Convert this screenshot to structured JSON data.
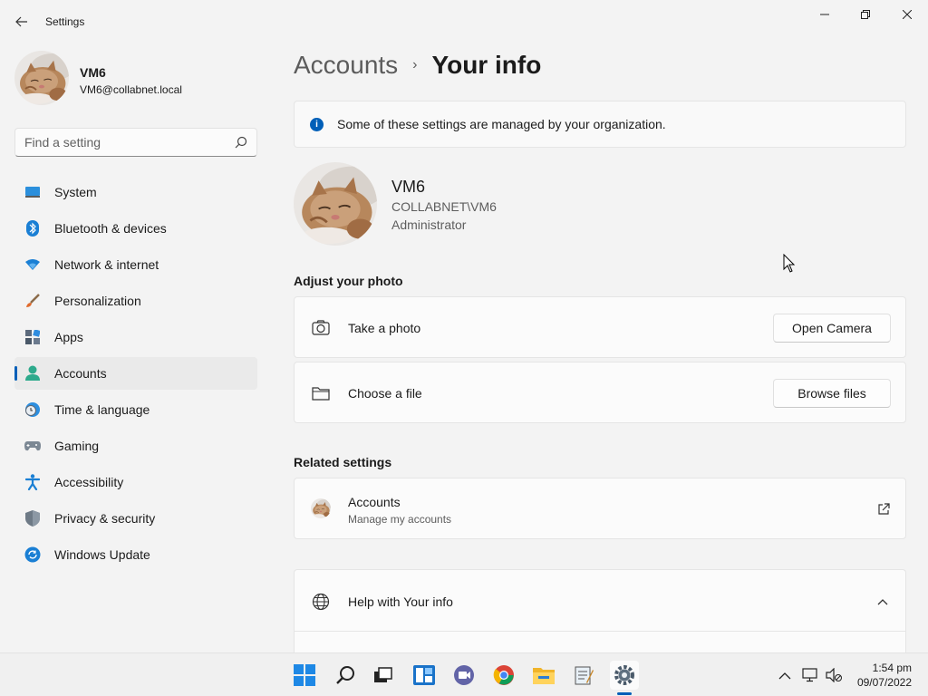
{
  "window": {
    "title": "Settings",
    "controls": {
      "minimize": "—",
      "maximize": "❐",
      "close": "✕"
    }
  },
  "profile": {
    "name": "VM6",
    "email": "VM6@collabnet.local"
  },
  "search": {
    "placeholder": "Find a setting"
  },
  "nav": [
    {
      "label": "System",
      "icon": "system-icon",
      "active": false
    },
    {
      "label": "Bluetooth & devices",
      "icon": "bluetooth-icon",
      "active": false
    },
    {
      "label": "Network & internet",
      "icon": "wifi-icon",
      "active": false
    },
    {
      "label": "Personalization",
      "icon": "brush-icon",
      "active": false
    },
    {
      "label": "Apps",
      "icon": "apps-icon",
      "active": false
    },
    {
      "label": "Accounts",
      "icon": "accounts-icon",
      "active": true
    },
    {
      "label": "Time & language",
      "icon": "clock-globe-icon",
      "active": false
    },
    {
      "label": "Gaming",
      "icon": "gamepad-icon",
      "active": false
    },
    {
      "label": "Accessibility",
      "icon": "accessibility-icon",
      "active": false
    },
    {
      "label": "Privacy & security",
      "icon": "shield-icon",
      "active": false
    },
    {
      "label": "Windows Update",
      "icon": "update-icon",
      "active": false
    }
  ],
  "breadcrumb": {
    "parent": "Accounts",
    "separator": "›",
    "current": "Your info"
  },
  "infobar": {
    "text": "Some of these settings are managed by your organization."
  },
  "user": {
    "name": "VM6",
    "domain": "COLLABNET\\VM6",
    "role": "Administrator"
  },
  "adjust_photo": {
    "title": "Adjust your photo",
    "take_photo": {
      "label": "Take a photo",
      "button": "Open Camera"
    },
    "choose_file": {
      "label": "Choose a file",
      "button": "Browse files"
    }
  },
  "related": {
    "title": "Related settings",
    "accounts": {
      "label": "Accounts",
      "sub": "Manage my accounts"
    }
  },
  "help": {
    "label": "Help with Your info"
  },
  "taskbar": {
    "apps": [
      "start-icon",
      "search-icon",
      "task-view-icon",
      "widgets-icon",
      "teams-chat-icon",
      "chrome-icon",
      "file-explorer-icon",
      "notepad-icon",
      "settings-icon"
    ],
    "time": "1:54 pm",
    "date": "09/07/2022"
  },
  "colors": {
    "accent": "#005fb8",
    "background": "#f3f3f3",
    "card": "#fbfbfb"
  }
}
